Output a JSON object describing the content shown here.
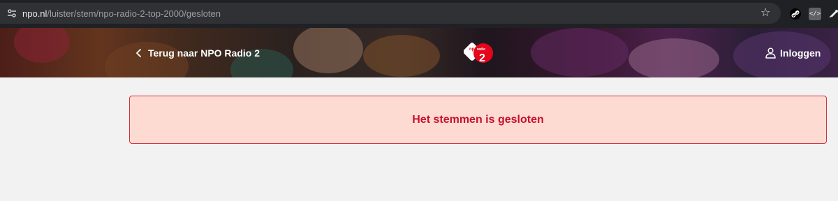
{
  "browser": {
    "url_host": "npo.nl",
    "url_path": "/luister/stem/npo-radio-2-top-2000/gesloten",
    "extension_code_label": "</>"
  },
  "header": {
    "back_label": "Terug naar NPO Radio 2",
    "logo_text_top": "npo",
    "logo_text_mid": "radio",
    "logo_text_num": "2",
    "login_label": "Inloggen"
  },
  "main": {
    "alert_message": "Het stemmen is gesloten"
  },
  "colors": {
    "alert_background": "#fddbd3",
    "alert_border": "#d42f3c",
    "alert_text": "#c8102e",
    "logo_red": "#e3051b",
    "page_background": "#f2f2f2"
  }
}
